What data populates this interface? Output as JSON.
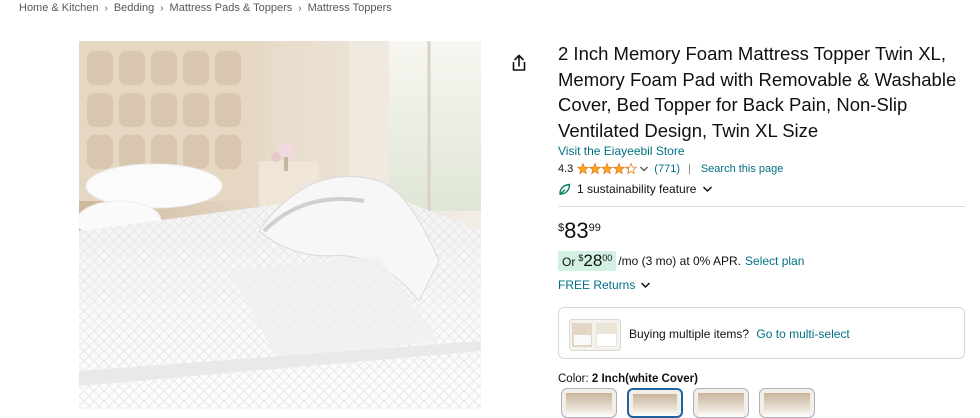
{
  "breadcrumb": [
    "Home & Kitchen",
    "Bedding",
    "Mattress Pads & Toppers",
    "Mattress Toppers"
  ],
  "breadcrumb_separator": "›",
  "product": {
    "title": "2 Inch Memory Foam Mattress Topper Twin XL, Memory Foam Pad with Removable & Washable Cover, Bed Topper for Back Pain, Non-Slip Ventilated Design, Twin XL Size",
    "store_link": "Visit the Eiayeebil Store",
    "rating": "4.3",
    "rating_stars_value": 4.3,
    "review_count": "(771)",
    "search_page_link": "Search this page",
    "sustainability": "1 sustainability feature"
  },
  "price": {
    "symbol": "$",
    "whole": "83",
    "fraction": "99"
  },
  "monthly": {
    "prefix": "Or",
    "symbol": "$",
    "whole": "28",
    "fraction": "00",
    "terms": "/mo (3 mo) at 0% APR.",
    "select_plan": "Select plan"
  },
  "returns": "FREE Returns",
  "multi_select": {
    "text": "Buying multiple items?",
    "link": "Go to multi-select"
  },
  "color": {
    "label": "Color:",
    "value": "2 Inch(white Cover)"
  },
  "colors": {
    "link": "#007185",
    "text": "#0f1111",
    "star": "#ffa41c",
    "green_chip": "#d3f1e3",
    "selected_border": "#2162a1"
  },
  "icons": [
    "share-icon",
    "star-icon",
    "chevron-down-icon",
    "leaf-icon"
  ]
}
